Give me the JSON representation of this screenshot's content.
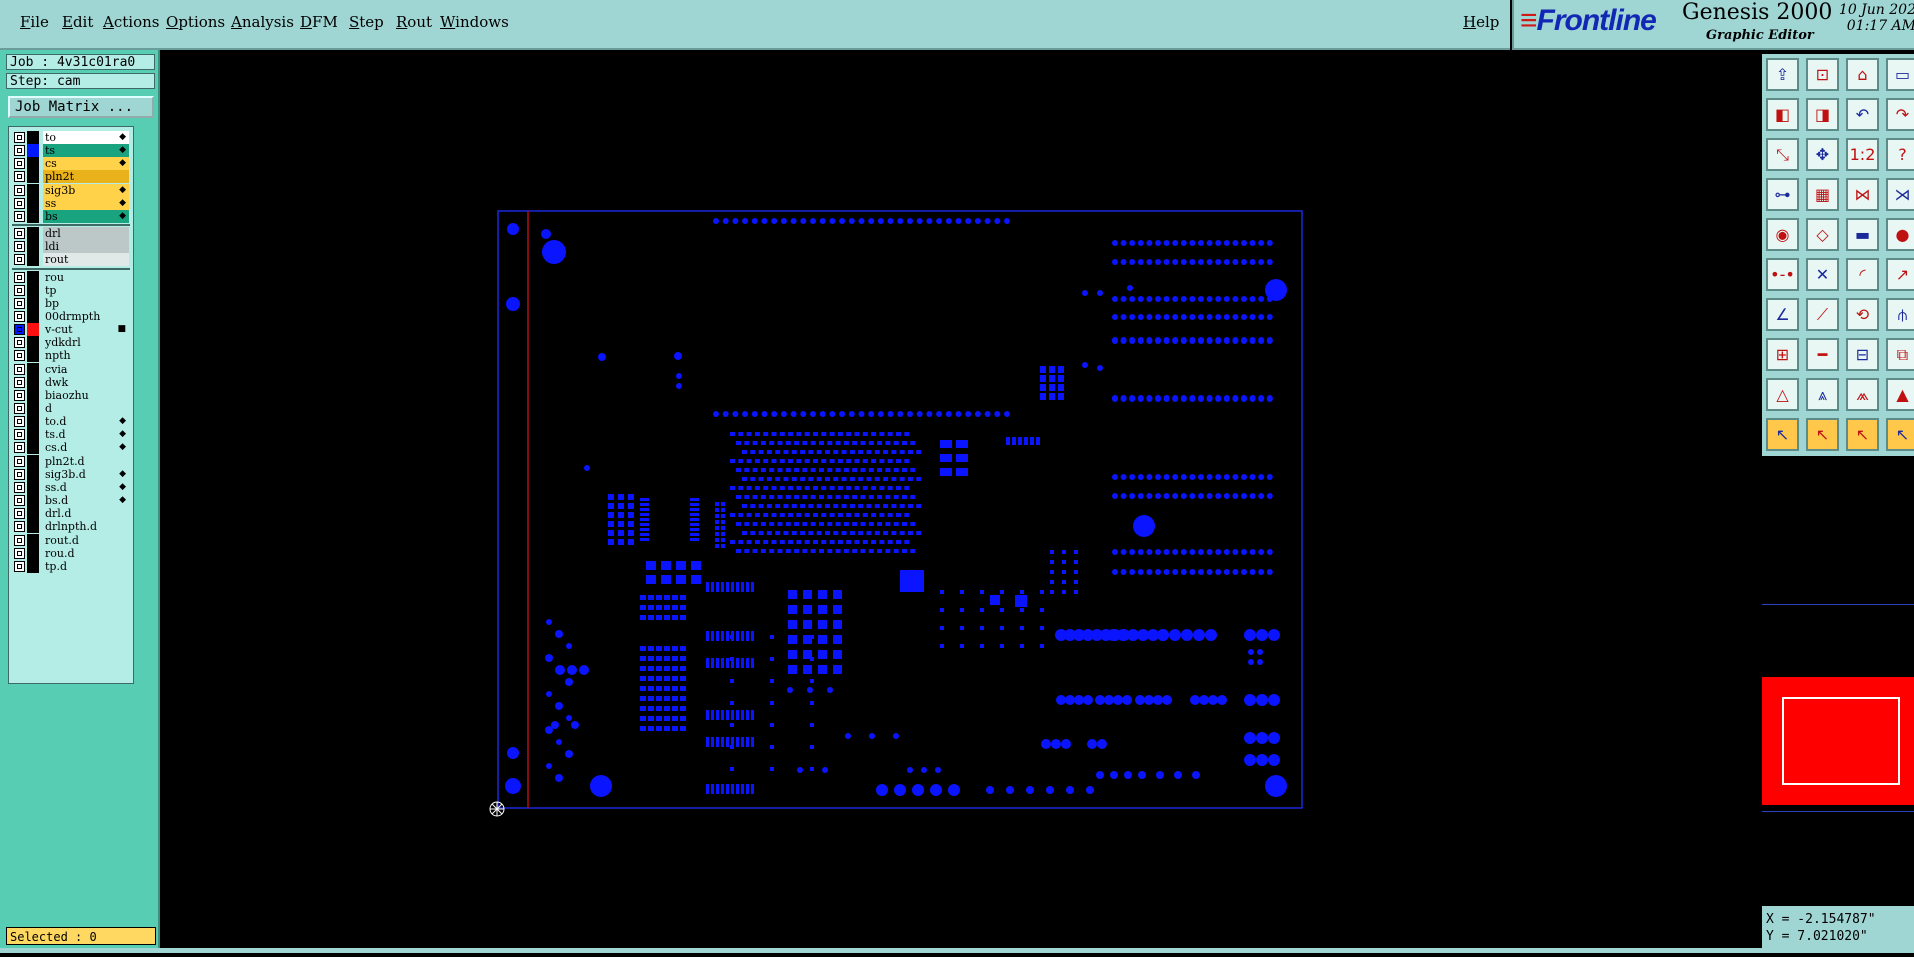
{
  "menubar": {
    "items": [
      "File",
      "Edit",
      "Actions",
      "Options",
      "Analysis",
      "DFM",
      "Step",
      "Rout",
      "Windows"
    ],
    "help": "Help"
  },
  "brand": {
    "logo": "Frontline",
    "product": "Genesis 2000",
    "subtitle": "Graphic Editor",
    "date": "10 Jun 202",
    "time": "01:17 AM"
  },
  "job": {
    "job_label": "Job : 4v31c01ra0",
    "step_label": "Step: cam",
    "matrix_button": "Job Matrix ..."
  },
  "layers": [
    {
      "name": "to",
      "bg": "#ffffff",
      "color": "#000000",
      "editable": true
    },
    {
      "name": "ts",
      "bg": "#1aa37f",
      "color": "#0018ff",
      "editable": true
    },
    {
      "name": "cs",
      "bg": "#ffd24a",
      "color": "#000000",
      "editable": true
    },
    {
      "name": "pln2t",
      "bg": "#e9b11a",
      "color": "#000000",
      "editable": false
    },
    {
      "name": "sig3b",
      "bg": "#ffd24a",
      "color": "#000000",
      "editable": true
    },
    {
      "name": "ss",
      "bg": "#ffd24a",
      "color": "#000000",
      "editable": true
    },
    {
      "name": "bs",
      "bg": "#1aa37f",
      "color": "#000000",
      "editable": true
    },
    {
      "name": "drl",
      "bg": "#bcc8c8",
      "color": "#000000",
      "editable": false
    },
    {
      "name": "ldi",
      "bg": "#bcc8c8",
      "color": "#000000",
      "editable": false
    },
    {
      "name": "rout",
      "bg": "#e0e8e8",
      "color": "#000000",
      "editable": false
    },
    {
      "name": "rou",
      "bg": "#b4ece6",
      "color": "#000000",
      "editable": false
    },
    {
      "name": "tp",
      "bg": "#b4ece6",
      "color": "#000000",
      "editable": false
    },
    {
      "name": "bp",
      "bg": "#b4ece6",
      "color": "#000000",
      "editable": false
    },
    {
      "name": "00drmpth",
      "bg": "#b4ece6",
      "color": "#000000",
      "editable": false
    },
    {
      "name": "v-cut",
      "bg": "#b4ece6",
      "color": "#ff1010",
      "editable": true,
      "active": true
    },
    {
      "name": "ydkdrl",
      "bg": "#b4ece6",
      "color": "#000000",
      "editable": false
    },
    {
      "name": "npth",
      "bg": "#b4ece6",
      "color": "#000000",
      "editable": false
    },
    {
      "name": "cvia",
      "bg": "#b4ece6",
      "color": "#000000",
      "editable": false
    },
    {
      "name": "dwk",
      "bg": "#b4ece6",
      "color": "#000000",
      "editable": false
    },
    {
      "name": "biaozhu",
      "bg": "#b4ece6",
      "color": "#000000",
      "editable": false
    },
    {
      "name": "d",
      "bg": "#b4ece6",
      "color": "#000000",
      "editable": false
    },
    {
      "name": "to.d",
      "bg": "#b4ece6",
      "color": "#000000",
      "editable": true
    },
    {
      "name": "ts.d",
      "bg": "#b4ece6",
      "color": "#000000",
      "editable": true
    },
    {
      "name": "cs.d",
      "bg": "#b4ece6",
      "color": "#000000",
      "editable": true
    },
    {
      "name": "pln2t.d",
      "bg": "#b4ece6",
      "color": "#000000",
      "editable": false
    },
    {
      "name": "sig3b.d",
      "bg": "#b4ece6",
      "color": "#000000",
      "editable": true
    },
    {
      "name": "ss.d",
      "bg": "#b4ece6",
      "color": "#000000",
      "editable": true
    },
    {
      "name": "bs.d",
      "bg": "#b4ece6",
      "color": "#000000",
      "editable": true
    },
    {
      "name": "drl.d",
      "bg": "#b4ece6",
      "color": "#000000",
      "editable": false
    },
    {
      "name": "drlnpth.d",
      "bg": "#b4ece6",
      "color": "#000000",
      "editable": false
    },
    {
      "name": "rout.d",
      "bg": "#b4ece6",
      "color": "#000000",
      "editable": false
    },
    {
      "name": "rou.d",
      "bg": "#b4ece6",
      "color": "#000000",
      "editable": false
    },
    {
      "name": "tp.d",
      "bg": "#b4ece6",
      "color": "#000000",
      "editable": false
    }
  ],
  "status": {
    "selected": "Selected : 0"
  },
  "coords": {
    "x": "X = -2.154787\"",
    "y": "Y = 7.021020\""
  },
  "colors": {
    "feature": "#0a14ff",
    "profile": "#1a28d8",
    "vcut": "#b01010",
    "panel_bg": "#57cdb4",
    "menubar_bg": "#9fd6d3"
  },
  "tools": [
    "snap-icon",
    "save-icon",
    "home-icon",
    "window-icon",
    "prev-icon",
    "next-icon",
    "undo-icon",
    "redo-icon",
    "zoom-fit-icon",
    "zoom-home-icon",
    "scale-1to2-icon",
    "help-icon",
    "measure-icon",
    "grid-icon",
    "net-icon",
    "select-net-icon",
    "pad-icon",
    "shape-icon",
    "ruler-icon",
    "circle-icon",
    "line-icon",
    "cross-icon",
    "arc-icon",
    "arrow-red-icon",
    "slant-icon",
    "diag-icon",
    "curve-icon",
    "split-icon",
    "move-icon",
    "dash-icon",
    "mirror-icon",
    "group-icon",
    "tri1-icon",
    "tri2-icon",
    "tri3-icon",
    "tri4-icon",
    "pointer-icon",
    "pointer2-icon",
    "pointer3-icon",
    "pointer4-icon"
  ]
}
